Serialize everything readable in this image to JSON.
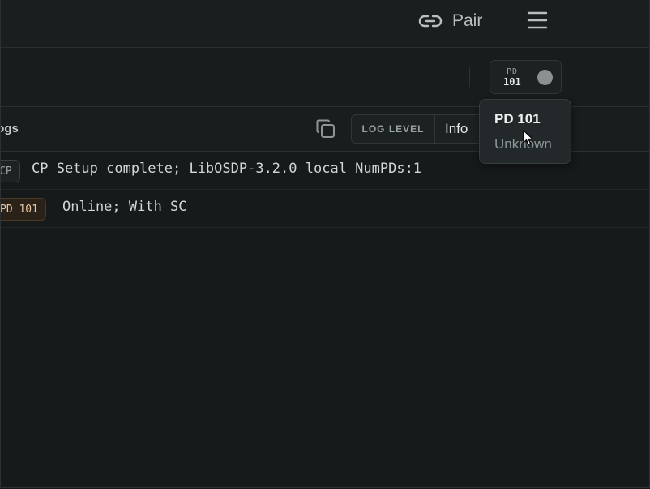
{
  "header": {
    "pair_label": "Pair",
    "pair_icon": "link-icon",
    "menu_icon": "hamburger-menu-icon"
  },
  "toolbar": {
    "pd_chip": {
      "line1": "PD",
      "line2": "101",
      "status_dot_color": "#8b9193"
    }
  },
  "tooltip": {
    "title": "PD 101",
    "status": "Unknown"
  },
  "logs": {
    "title": "Logs",
    "copy_icon": "copy-icon",
    "log_level_label": "LOG LEVEL",
    "log_level_value": "Info",
    "entries": [
      {
        "source": "CP",
        "message": "CP Setup complete; LibOSDP-3.2.0 local NumPDs:1"
      },
      {
        "source": "PD 101",
        "message": "Online; With SC"
      }
    ]
  },
  "colors": {
    "background": "#161a1b",
    "pd_badge_text": "#e7c9a3",
    "pd_badge_border": "#4a3a24"
  }
}
